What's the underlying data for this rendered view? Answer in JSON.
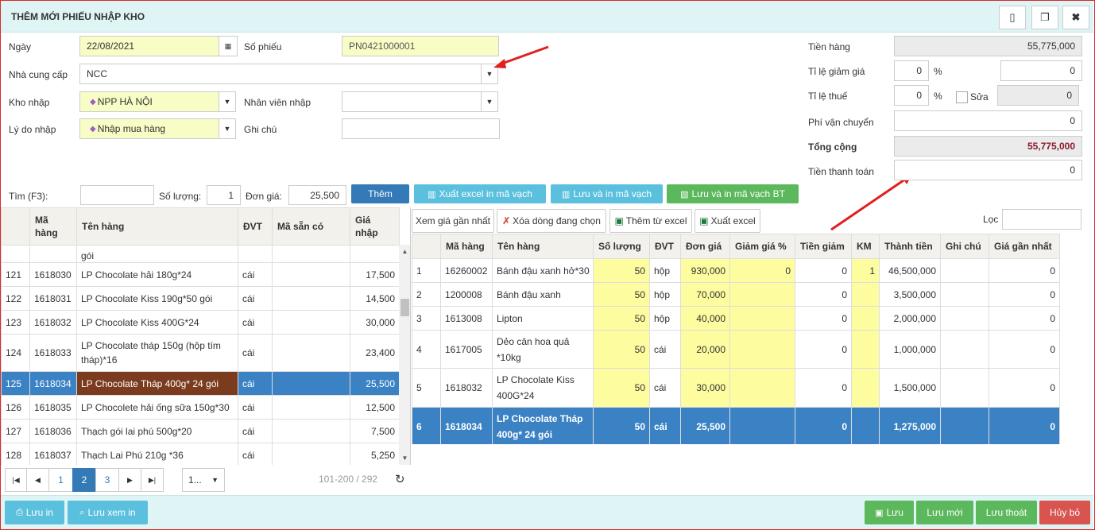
{
  "title": "THÊM MỚI PHIẾU NHẬP KHO",
  "form": {
    "ngay_label": "Ngày",
    "ngay_value": "22/08/2021",
    "so_phieu_label": "Số phiếu",
    "so_phieu_value": "PN0421000001",
    "ncc_label": "Nhà cung cấp",
    "ncc_value": "NCC",
    "kho_label": "Kho nhập",
    "kho_value": "NPP HÀ NỘI",
    "nv_label": "Nhân viên nhập",
    "nv_value": "",
    "lydo_label": "Lý do nhập",
    "lydo_value": "Nhập mua hàng",
    "ghichu_label": "Ghi chú",
    "ghichu_value": ""
  },
  "totals": {
    "tien_hang_label": "Tiền hàng",
    "tien_hang": "55,775,000",
    "giam_gia_label": "Tỉ lệ giảm giá",
    "giam_gia_pct": "0",
    "giam_gia_val": "0",
    "thue_label": "Tỉ lệ thuế",
    "thue_pct": "0",
    "thue_val": "0",
    "sua_label": "Sửa",
    "pct": "%",
    "ship_label": "Phí vận chuyển",
    "ship": "0",
    "tong_label": "Tổng cộng",
    "tong": "55,775,000",
    "thanh_toan_label": "Tiền thanh toán",
    "thanh_toan": "0"
  },
  "search": {
    "tim_label": "Tìm (F3):",
    "tim_value": "",
    "sl_label": "Số lượng:",
    "sl_value": "1",
    "dg_label": "Đơn giá:",
    "dg_value": "25,500",
    "them": "Thêm",
    "xuat_ma_vach": "Xuất excel in mã vạch",
    "luu_ma_vach": "Lưu và in mã vạch",
    "luu_ma_vach_bt": "Lưu và in mã vạch BT"
  },
  "left_table": {
    "headers": [
      "",
      "Mã hàng",
      "Tên hàng",
      "ĐVT",
      "Mã sẵn có",
      "Giá nhập"
    ],
    "partial": "gói",
    "rows": [
      {
        "no": "121",
        "ma": "1618030",
        "ten": "LP Chocolate hải 180g*24",
        "dvt": "cái",
        "sc": "",
        "gia": "17,500"
      },
      {
        "no": "122",
        "ma": "1618031",
        "ten": "LP Chocolate Kiss 190g*50 gói",
        "dvt": "cái",
        "sc": "",
        "gia": "14,500"
      },
      {
        "no": "123",
        "ma": "1618032",
        "ten": "LP Chocolate Kiss 400G*24",
        "dvt": "cái",
        "sc": "",
        "gia": "30,000"
      },
      {
        "no": "124",
        "ma": "1618033",
        "ten": "LP Chocolate tháp 150g (hộp tím tháp)*16",
        "dvt": "cái",
        "sc": "",
        "gia": "23,400"
      },
      {
        "no": "125",
        "ma": "1618034",
        "ten": "LP Chocolate Tháp 400g* 24 gói",
        "dvt": "cái",
        "sc": "",
        "gia": "25,500"
      },
      {
        "no": "126",
        "ma": "1618035",
        "ten": "LP Chocolete hải ống sữa 150g*30",
        "dvt": "cái",
        "sc": "",
        "gia": "12,500"
      },
      {
        "no": "127",
        "ma": "1618036",
        "ten": "Thạch gói lai phú 500g*20",
        "dvt": "cái",
        "sc": "",
        "gia": "7,500"
      },
      {
        "no": "128",
        "ma": "1618037",
        "ten": "Thạch Lai Phú 210g *36",
        "dvt": "cái",
        "sc": "",
        "gia": "5,250"
      }
    ]
  },
  "pager": {
    "p1": "1",
    "p2": "2",
    "p3": "3",
    "size": "1...",
    "info": "101-200 / 292"
  },
  "right_toolbar": {
    "xem_gia": "Xem giá gần nhất",
    "xoa_dong": "Xóa dòng đang chọn",
    "them_excel": "Thêm từ excel",
    "xuat_excel": "Xuất excel",
    "loc_label": "Lọc",
    "loc_value": ""
  },
  "right_table": {
    "headers": [
      "",
      "Mã hàng",
      "Tên hàng",
      "Số lượng",
      "ĐVT",
      "Đơn giá",
      "Giảm giá %",
      "Tiền giảm",
      "KM",
      "Thành tiền",
      "Ghi chú",
      "Giá gần nhất"
    ],
    "rows": [
      {
        "no": "1",
        "ma": "16260002",
        "ten": "Bánh đậu xanh hở*30",
        "sl": "50",
        "dvt": "hộp",
        "dg": "930,000",
        "gg": "0",
        "tg": "0",
        "km": "1",
        "tt": "46,500,000",
        "gc": "",
        "ggn": "0"
      },
      {
        "no": "2",
        "ma": "1200008",
        "ten": "Bánh đậu xanh",
        "sl": "50",
        "dvt": "hộp",
        "dg": "70,000",
        "gg": "",
        "tg": "0",
        "km": "",
        "tt": "3,500,000",
        "gc": "",
        "ggn": "0"
      },
      {
        "no": "3",
        "ma": "1613008",
        "ten": "Lipton",
        "sl": "50",
        "dvt": "hộp",
        "dg": "40,000",
        "gg": "",
        "tg": "0",
        "km": "",
        "tt": "2,000,000",
        "gc": "",
        "ggn": "0"
      },
      {
        "no": "4",
        "ma": "1617005",
        "ten": "Dẻo cân hoa quả *10kg",
        "sl": "50",
        "dvt": "cái",
        "dg": "20,000",
        "gg": "",
        "tg": "0",
        "km": "",
        "tt": "1,000,000",
        "gc": "",
        "ggn": "0"
      },
      {
        "no": "5",
        "ma": "1618032",
        "ten": "LP Chocolate Kiss 400G*24",
        "sl": "50",
        "dvt": "cái",
        "dg": "30,000",
        "gg": "",
        "tg": "0",
        "km": "",
        "tt": "1,500,000",
        "gc": "",
        "ggn": "0"
      },
      {
        "no": "6",
        "ma": "1618034",
        "ten": "LP Chocolate Tháp 400g* 24 gói",
        "sl": "50",
        "dvt": "cái",
        "dg": "25,500",
        "gg": "",
        "tg": "0",
        "km": "",
        "tt": "1,275,000",
        "gc": "",
        "ggn": "0"
      }
    ]
  },
  "footer": {
    "luu_in": "Lưu in",
    "luu_xem_in": "Lưu xem in",
    "luu": "Lưu",
    "luu_moi": "Lưu mới",
    "luu_thoat": "Lưu thoát",
    "huy_bo": "Hủy bỏ"
  },
  "colors": {
    "primary": "#337ab7",
    "info": "#5bc0de",
    "success": "#5cb85c",
    "danger": "#d9534f",
    "highlight": "#f8fdc6"
  }
}
